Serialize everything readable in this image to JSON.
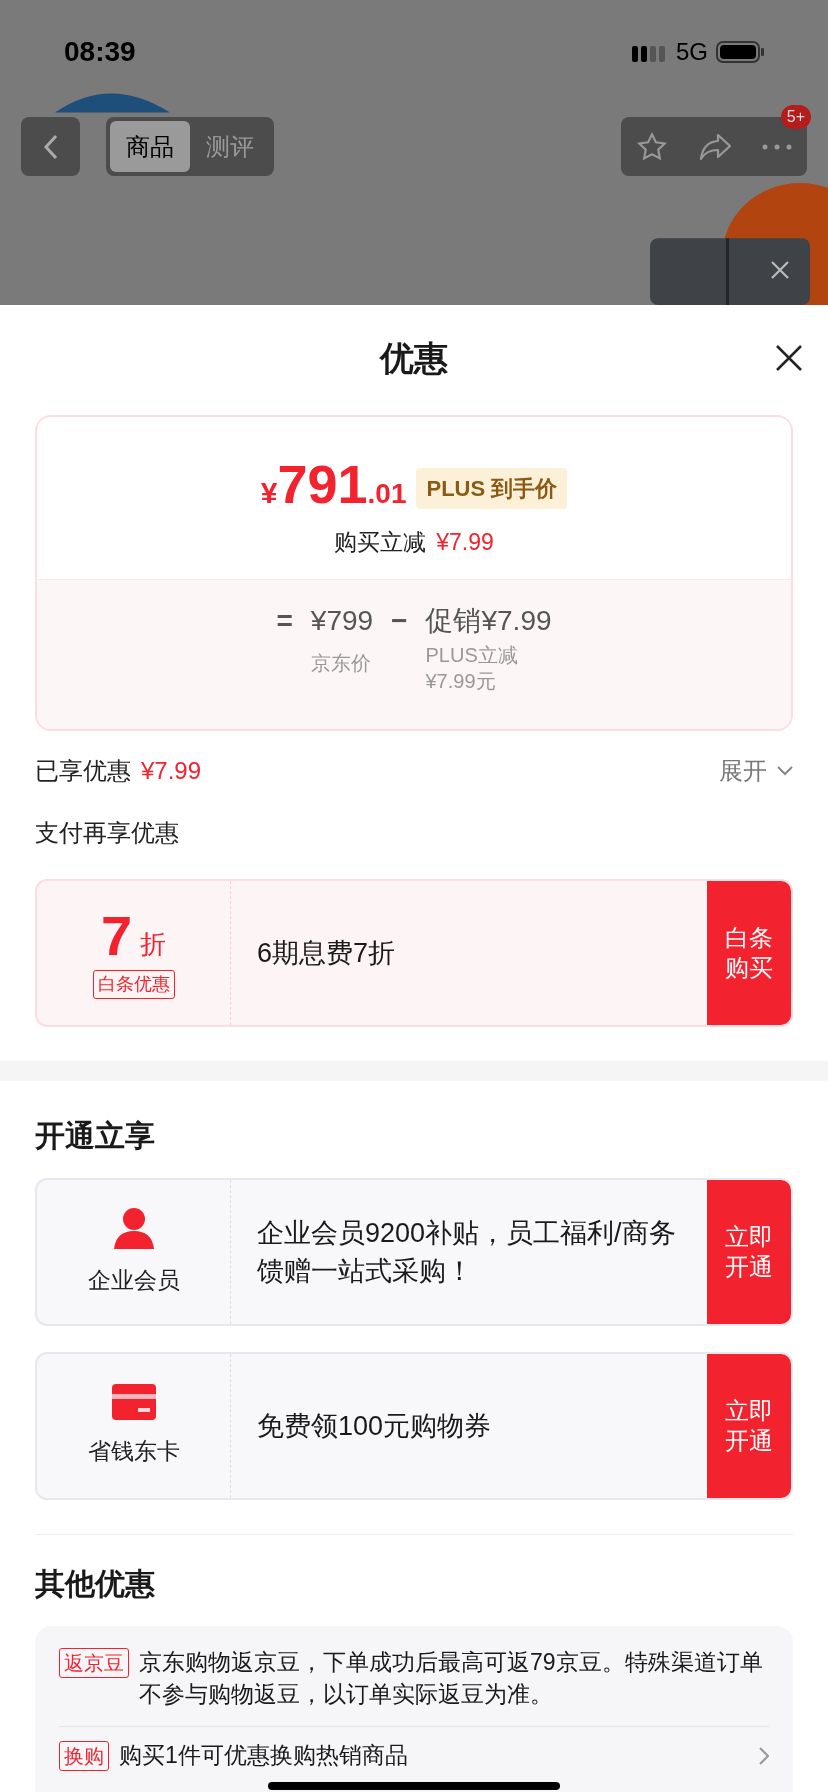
{
  "status_bar": {
    "time": "08:39",
    "network": "5G"
  },
  "nav": {
    "tabs": [
      {
        "label": "商品",
        "selected": true
      },
      {
        "label": "测评",
        "selected": false
      }
    ],
    "badge": "5+"
  },
  "sheet": {
    "title": "优惠"
  },
  "price_card": {
    "currency": "¥",
    "integer": "791",
    "decimal": ".01",
    "tag": "PLUS 到手价",
    "reduce_label": "购买立减",
    "reduce_amount": "¥7.99",
    "formula": {
      "equals": "=",
      "base": "¥799",
      "base_label": "京东价",
      "minus": "−",
      "promo": "促销¥7.99",
      "promo_label": [
        "PLUS立减",
        "¥7.99元"
      ]
    }
  },
  "enjoyed": {
    "label": "已享优惠",
    "amount": "¥7.99",
    "expand": "展开"
  },
  "pay_section": {
    "title": "支付再享优惠",
    "offers": [
      {
        "discount": "7",
        "unit": "折",
        "tag": "白条优惠",
        "desc": "6期息费7折",
        "action": "白条购买"
      }
    ]
  },
  "open_section": {
    "title": "开通立享",
    "items": [
      {
        "kind": "member",
        "name": "企业会员",
        "desc": "企业会员9200补贴，员工福利/商务馈赠一站式采购！",
        "action": "立即开通"
      },
      {
        "kind": "card",
        "name": "省钱东卡",
        "desc": "免费领100元购物券",
        "action": "立即开通"
      }
    ]
  },
  "other_section": {
    "title": "其他优惠",
    "items": [
      {
        "kind": "info",
        "tag": "返京豆",
        "text": "京东购物返京豆，下单成功后最高可返79京豆。特殊渠道订单不参与购物返豆，以订单实际返豆为准。"
      },
      {
        "kind": "link",
        "tag": "换购",
        "text": "购买1件可优惠换购热销商品"
      }
    ]
  }
}
